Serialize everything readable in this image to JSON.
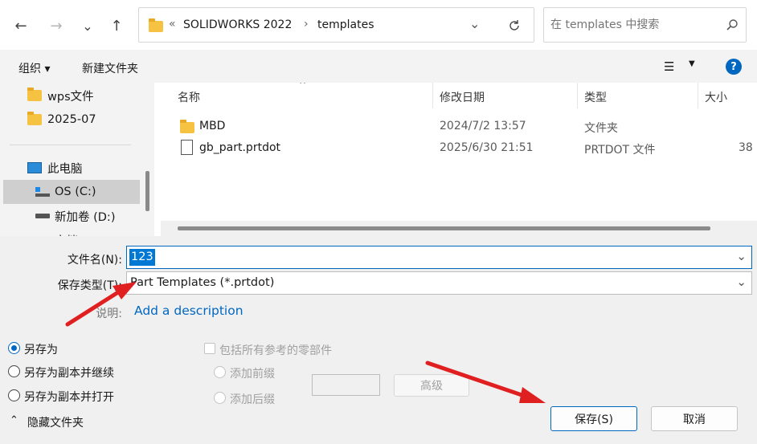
{
  "nav": {
    "back": "←",
    "forward": "→",
    "recent": "⌄",
    "up": "↑"
  },
  "address": {
    "prefix": "«",
    "crumbs": [
      "SOLIDWORKS 2022",
      "templates"
    ],
    "sep": "›"
  },
  "search": {
    "placeholder": "在 templates 中搜索"
  },
  "toolbar": {
    "organize": "组织 ▾",
    "new_folder": "新建文件夹",
    "help": "?"
  },
  "sidebar": {
    "items": [
      {
        "label": "wps文件",
        "icon": "folder-icon"
      },
      {
        "label": "2025-07",
        "icon": "folder-icon"
      },
      {
        "label": "此电脑",
        "icon": "computer-icon"
      },
      {
        "label": "OS (C:)",
        "icon": "windows-drive-icon"
      },
      {
        "label": "新加卷 (D:)",
        "icon": "drive-icon"
      },
      {
        "label": "文档",
        "icon": "drive-icon"
      }
    ]
  },
  "columns": {
    "name": "名称",
    "modified": "修改日期",
    "type": "类型",
    "size": "大小"
  },
  "files": [
    {
      "name": "MBD",
      "modified": "2024/7/2 13:57",
      "type": "文件夹",
      "size": "",
      "icon": "folder-icon"
    },
    {
      "name": "gb_part.prtdot",
      "modified": "2025/6/30 21:51",
      "type": "PRTDOT 文件",
      "size": "38",
      "icon": "file-icon"
    }
  ],
  "form": {
    "filename_label": "文件名(N):",
    "filename_value": "123",
    "filetype_label": "保存类型(T):",
    "filetype_value": "Part Templates (*.prtdot)",
    "desc_label": "说明:",
    "desc_link": "Add a description"
  },
  "options": {
    "save_as": "另存为",
    "save_copy_continue": "另存为副本并继续",
    "save_copy_open": "另存为副本并打开",
    "include_refs": "包括所有参考的零部件",
    "add_prefix": "添加前缀",
    "add_suffix": "添加后缀",
    "advanced": "高级",
    "hide_folders": "隐藏文件夹"
  },
  "buttons": {
    "save": "保存(S)",
    "cancel": "取消"
  },
  "colors": {
    "accent": "#0067c0",
    "annotation_arrow": "#e02020",
    "selection": "#0078d4"
  }
}
